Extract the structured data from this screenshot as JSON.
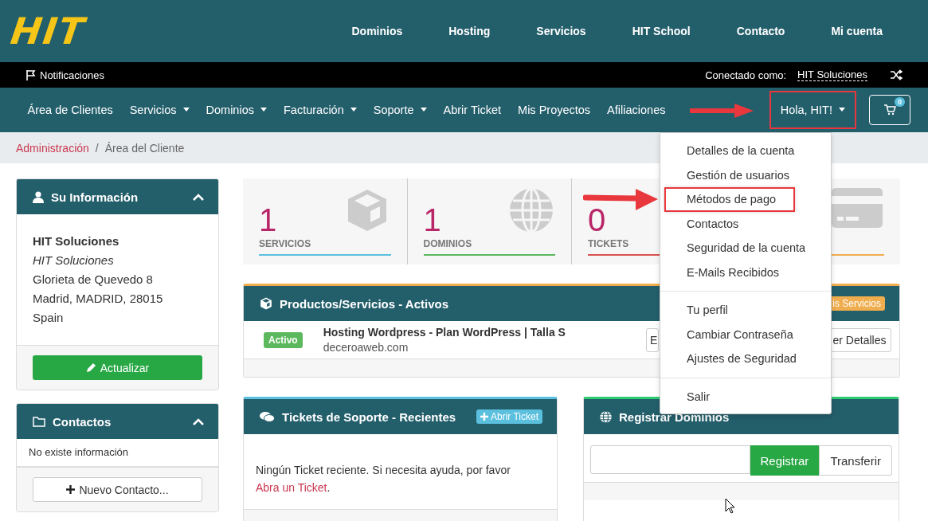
{
  "logo": "HIT",
  "top_nav": [
    "Dominios",
    "Hosting",
    "Servicios",
    "HIT School",
    "Contacto",
    "Mi cuenta"
  ],
  "notifications": "Notificaciones",
  "connected_label": "Conectado como:",
  "connected_user": "HIT Soluciones",
  "main_nav": [
    {
      "label": "Área de Clientes",
      "dropdown": false
    },
    {
      "label": "Servicios",
      "dropdown": true
    },
    {
      "label": "Dominios",
      "dropdown": true
    },
    {
      "label": "Facturación",
      "dropdown": true
    },
    {
      "label": "Soporte",
      "dropdown": true
    },
    {
      "label": "Abrir Ticket",
      "dropdown": false
    },
    {
      "label": "Mis Proyectos",
      "dropdown": false
    },
    {
      "label": "Afiliaciones",
      "dropdown": false
    }
  ],
  "user_menu": {
    "label": "Hola, HIT!",
    "expanded": true,
    "highlighted": true
  },
  "cart": {
    "count": "0"
  },
  "breadcrumb_separator": "/",
  "breadcrumb": [
    {
      "label": "Administración",
      "link": true
    },
    {
      "label": "Área del Cliente",
      "link": false
    }
  ],
  "dropdown": [
    [
      {
        "label": "Detalles de la cuenta",
        "highlighted": false
      },
      {
        "label": "Gestión de usuarios",
        "highlighted": false
      },
      {
        "label": "Métodos de pago",
        "highlighted": true
      },
      {
        "label": "Contactos",
        "highlighted": false
      },
      {
        "label": "Seguridad de la cuenta",
        "highlighted": false
      },
      {
        "label": "E-Mails Recibidos",
        "highlighted": false
      }
    ],
    [
      {
        "label": "Tu perfil",
        "highlighted": false
      },
      {
        "label": "Cambiar Contraseña",
        "highlighted": false
      },
      {
        "label": "Ajustes de Seguridad",
        "highlighted": false
      }
    ],
    [
      {
        "label": "Salir",
        "highlighted": false
      }
    ]
  ],
  "info_panel": {
    "title": "Su Información",
    "expanded": true,
    "name": "HIT Soluciones",
    "company": "HIT Soluciones",
    "address": [
      "Glorieta de Quevedo 8",
      "Madrid, MADRID, 28015",
      "Spain"
    ],
    "button": "Actualizar"
  },
  "contacts_panel": {
    "title": "Contactos",
    "expanded": true,
    "empty": "No existe información",
    "button": "Nuevo Contacto..."
  },
  "stats": [
    {
      "kind": "box",
      "value": "1",
      "label": "SERVICIOS",
      "color": "#5bc0de"
    },
    {
      "kind": "globe",
      "value": "1",
      "label": "DOMINIOS",
      "color": "#5cb85c"
    },
    {
      "kind": "none",
      "value": "0",
      "label": "TICKETS",
      "color": "#d9534f"
    },
    {
      "kind": "card",
      "color": "#f0ad4e"
    }
  ],
  "products_panel": {
    "title": "Productos/Servicios - Activos",
    "header_button": "is Servicios",
    "rows": [
      {
        "status": "Activo",
        "name": "Hosting Wordpress - Plan WordPress | Talla S",
        "domain": "deceroaweb.com",
        "buttons": [
          "E",
          "er Detalles"
        ]
      }
    ]
  },
  "tickets_panel": {
    "title": "Tickets de Soporte - Recientes",
    "header_button": "Abrir Ticket",
    "message": "Ningún Ticket reciente. Si necesita ayuda, por favor ",
    "link": "Abra un Ticket",
    "end": "."
  },
  "domains_panel": {
    "title": "Registrar Dominios",
    "buttons": [
      "Registrar",
      "Transferir"
    ]
  }
}
